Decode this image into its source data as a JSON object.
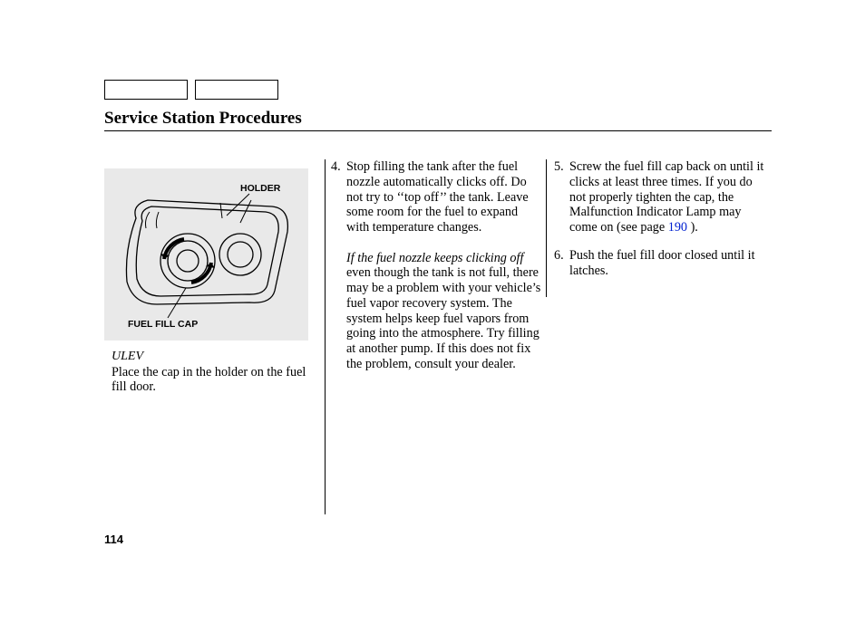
{
  "title": "Service Station Procedures",
  "pageNumber": "114",
  "figure": {
    "holderLabel": "HOLDER",
    "capLabel": "FUEL FILL CAP"
  },
  "column1": {
    "ulev": "ULEV",
    "text": "Place the cap in the holder on the fuel fill door."
  },
  "steps": {
    "s4": {
      "num": "4.",
      "body1": "Stop filling the tank after the fuel nozzle automatically clicks off. Do not try to ‘‘top off’’ the tank. Leave some room for the fuel to expand with temperature changes.",
      "italic": "If the fuel nozzle keeps clicking off",
      "body2": "even though the tank is not full, there may be a problem with your vehicle’s fuel vapor recovery system. The system helps keep fuel vapors from going into the atmosphere. Try filling at another pump. If this does not fix the problem, consult your dealer."
    },
    "s5": {
      "num": "5.",
      "body_pre": "Screw the fuel fill cap back on until it clicks at least three times. If you do not properly tighten the cap, the Malfunction Indicator Lamp may come on (see page ",
      "link": "190",
      "body_post": " )."
    },
    "s6": {
      "num": "6.",
      "body": "Push the fuel fill door closed until it latches."
    }
  }
}
